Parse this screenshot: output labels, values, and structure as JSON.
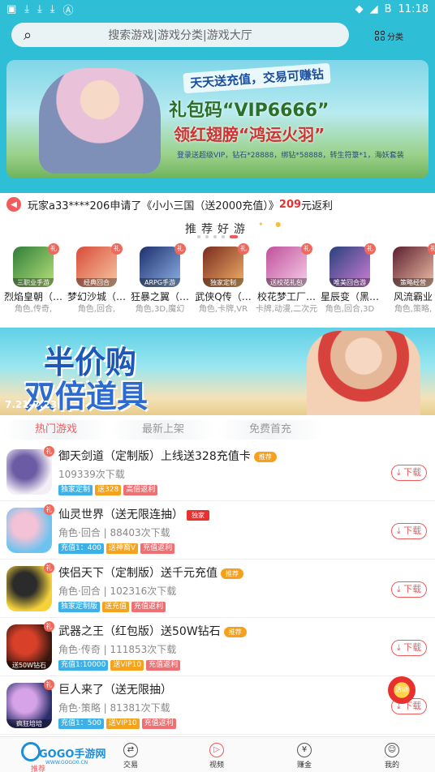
{
  "status_bar": {
    "time": "11:18",
    "notification_icons": [
      "download-icon",
      "download-icon",
      "download-icon",
      "download-icon",
      "a-icon"
    ],
    "battery": "B"
  },
  "header": {
    "search_placeholder": "搜索游戏|游戏分类|游戏大厅",
    "category_label": "分类"
  },
  "banner": {
    "line1": "天天送充值，交易可赚钻",
    "line2": "礼包码“VIP6666”",
    "line3": "领红翅膀“鸿运火羽”",
    "line4": "登录送超级VIP，钻石*28888，绑钻*58888，转生符箓*1，海妖套装",
    "active_dot": 4,
    "dot_count": 5
  },
  "ticker": {
    "prefix": "玩家a33****206申请了《小小三国（送2000充值）》",
    "amount": "209",
    "suffix": "元返利"
  },
  "recommend": {
    "title": "推荐好游",
    "items": [
      {
        "name": "烈焰皇朝（…",
        "tags": "角色,传奇,",
        "icon_label": "三职业手游",
        "colors": [
          "#2f7d3a",
          "#b9e37a"
        ]
      },
      {
        "name": "梦幻沙城（…",
        "tags": "角色,回合,",
        "icon_label": "经典回合",
        "colors": [
          "#d94b3a",
          "#f7c9a3"
        ]
      },
      {
        "name": "狂暴之翼（…",
        "tags": "角色,3D,魔幻",
        "icon_label": "ARPG手游",
        "colors": [
          "#1d2f6e",
          "#8fb3e6"
        ]
      },
      {
        "name": "武侠Q传（…",
        "tags": "角色,卡牌,VR",
        "icon_label": "独家定制",
        "colors": [
          "#7a2a1e",
          "#f2b36a"
        ]
      },
      {
        "name": "校花梦工厂…",
        "tags": "卡牌,动漫,二次元",
        "icon_label": "送校花礼包",
        "colors": [
          "#c04f9a",
          "#f6d0ea"
        ]
      },
      {
        "name": "星辰变（黑…",
        "tags": "角色,回合,3D",
        "icon_label": "唯美回合游",
        "colors": [
          "#28407d",
          "#d07fd4"
        ]
      },
      {
        "name": "风流霸业",
        "tags": "角色,策略,",
        "icon_label": "策略经营",
        "colors": [
          "#5b1e2e",
          "#f1c1a8"
        ]
      }
    ]
  },
  "promo": {
    "line1": "半价购",
    "line2": "双倍道具",
    "dates": "7.21-7.23"
  },
  "tabs": [
    {
      "label": "热门游戏",
      "active": true
    },
    {
      "label": "最新上架",
      "active": false
    },
    {
      "label": "免费首充",
      "active": false
    }
  ],
  "games": [
    {
      "title": "御天剑道（定制版）上线送328充值卡",
      "flag": "推荐",
      "flag_style": "orange",
      "meta": "109339次下载",
      "chips": [
        {
          "text": "独家定制",
          "color": "blue"
        },
        {
          "text": "送328",
          "color": "orange"
        },
        {
          "text": "高倍返利",
          "color": "pink"
        }
      ],
      "icon_caption": "",
      "colors": [
        "#f3eef5",
        "#6b5aa4"
      ],
      "download_label": "下载"
    },
    {
      "title": "仙灵世界（送无限连抽）",
      "flag": "独家",
      "flag_style": "red",
      "meta": "角色·回合 | 88403次下载",
      "chips": [
        {
          "text": "充值1：400",
          "color": "blue"
        },
        {
          "text": "送神裔V",
          "color": "orange"
        },
        {
          "text": "充值返利",
          "color": "pink"
        }
      ],
      "icon_caption": "",
      "colors": [
        "#6bc3f0",
        "#f3c2d6"
      ],
      "download_label": "下载"
    },
    {
      "title": "侠侣天下（定制版）送千元充值",
      "flag": "推荐",
      "flag_style": "orange",
      "meta": "角色·回合 | 102316次下载",
      "chips": [
        {
          "text": "独家定制版",
          "color": "blue"
        },
        {
          "text": "送充值",
          "color": "orange"
        },
        {
          "text": "充值返利",
          "color": "pink"
        }
      ],
      "icon_caption": "",
      "colors": [
        "#f5d23a",
        "#2b2b2b"
      ],
      "download_label": "下载"
    },
    {
      "title": "武器之王（红包版）送50W钻石",
      "flag": "推荐",
      "flag_style": "orange",
      "meta": "角色·传奇 | 111853次下载",
      "chips": [
        {
          "text": "充值1:10000",
          "color": "blue"
        },
        {
          "text": "送VIP10",
          "color": "orange"
        },
        {
          "text": "充值返利",
          "color": "pink"
        }
      ],
      "icon_caption": "送50W钻石",
      "colors": [
        "#3a1810",
        "#d8402a"
      ],
      "download_label": "下载"
    },
    {
      "title": "巨人来了（送无限抽）",
      "flag": "",
      "flag_style": "",
      "meta": "角色·策略 | 81381次下载",
      "chips": [
        {
          "text": "充值1：500",
          "color": "blue"
        },
        {
          "text": "送VIP10",
          "color": "orange"
        },
        {
          "text": "充值返利",
          "color": "pink"
        }
      ],
      "icon_caption": "疯狂培培",
      "colors": [
        "#2a2f6a",
        "#d7a3e8"
      ],
      "download_label": "下载"
    }
  ],
  "float_badge": "活动",
  "bottom_nav": {
    "logo_text": "GOGO手游网",
    "logo_url_text": "WWW.GOGO0.CN",
    "logo_sub": "推荐",
    "items": [
      {
        "label": "交易",
        "icon": "trade-icon"
      },
      {
        "label": "视频",
        "icon": "play-icon"
      },
      {
        "label": "赚金",
        "icon": "coin-icon"
      },
      {
        "label": "我的",
        "icon": "user-icon"
      }
    ]
  }
}
